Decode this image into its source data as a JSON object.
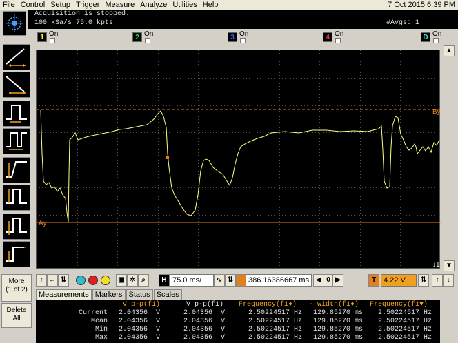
{
  "menu": [
    "File",
    "Control",
    "Setup",
    "Trigger",
    "Measure",
    "Analyze",
    "Utilities",
    "Help"
  ],
  "datetime": "7 Oct 2015  6:39 PM",
  "status": {
    "line1": "Acquisition is stopped.",
    "line2": "100 kSa/s    75.0 kpts",
    "avgs": "#Avgs: 1"
  },
  "channels": [
    {
      "id": "1",
      "state": "On",
      "color": "#ffff00"
    },
    {
      "id": "2",
      "state": "On",
      "color": "#20e020"
    },
    {
      "id": "3",
      "state": "On",
      "color": "#3060ff"
    },
    {
      "id": "4",
      "state": "On",
      "color": "#ff3060"
    },
    {
      "id": "D",
      "state": "On",
      "color": "#40e0e0"
    }
  ],
  "scope": {
    "marker_by": "By",
    "marker_ay": "Ay",
    "trigger_marker": "↓1"
  },
  "left": {
    "more": "More",
    "more_page": "(1 of 2)",
    "delete": "Delete",
    "delete_all": "All"
  },
  "controls": {
    "h_label": "H",
    "timebase": "75.0 ms/",
    "delay": "386.16386667 ms",
    "zero": "0",
    "t_label": "T",
    "trigger_level": "4.22 V"
  },
  "tabs": [
    "Measurements",
    "Markers",
    "Status",
    "Scales"
  ],
  "measurements": {
    "headers": [
      "V p-p(f1)",
      "V p-p(f1)",
      "Frequency(f1♦)",
      "- width(f1♦)",
      "Frequency(f1▼)"
    ],
    "rows": [
      {
        "label": "Current",
        "vals": [
          "2.04356  V",
          "2.04356  V",
          "2.50224517 Hz",
          "129.85270 ms",
          "2.50224517 Hz"
        ]
      },
      {
        "label": "Mean",
        "vals": [
          "2.04356  V",
          "2.04356  V",
          "2.50224517 Hz",
          "129.85270 ms",
          "2.50224517 Hz"
        ]
      },
      {
        "label": "Min",
        "vals": [
          "2.04356  V",
          "2.04356  V",
          "2.50224517 Hz",
          "129.85270 ms",
          "2.50224517 Hz"
        ]
      },
      {
        "label": "Max",
        "vals": [
          "2.04356  V",
          "2.04356  V",
          "2.50224517 Hz",
          "129.85270 ms",
          "2.50224517 Hz"
        ]
      }
    ]
  },
  "colors": {
    "trace": "#ffff80",
    "marker": "#e08020",
    "grid": "#505050"
  }
}
